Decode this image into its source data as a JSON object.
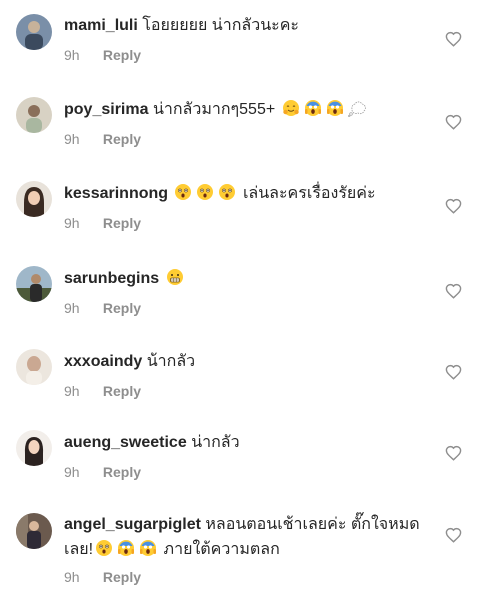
{
  "comments": [
    {
      "username": "mami_luli",
      "text": "โอยยยยย น่ากลัวนะคะ",
      "time": "9h",
      "reply_label": "Reply",
      "avatar_icon": "user-avatar-photo",
      "avatar_colors": [
        "#7a8fa8",
        "#c7b29a"
      ]
    },
    {
      "username": "poy_sirima",
      "text": "น่ากลัวมากๆ555+",
      "emojis": [
        "hugging-face-emoji",
        "screaming-face-emoji",
        "screaming-face-emoji",
        "thought-bubble-emoji"
      ],
      "time": "9h",
      "reply_label": "Reply",
      "avatar_icon": "user-avatar-photo",
      "avatar_colors": [
        "#d8d2c4",
        "#8a6f5a"
      ]
    },
    {
      "username": "kessarinnong",
      "emojis": [
        "astonished-face-emoji",
        "astonished-face-emoji",
        "astonished-face-emoji"
      ],
      "text_after": "เล่นละครเรื่องรัยค่ะ",
      "time": "9h",
      "reply_label": "Reply",
      "avatar_icon": "user-avatar-photo",
      "avatar_colors": [
        "#e8e2da",
        "#3a2a22"
      ]
    },
    {
      "username": "sarunbegins",
      "emojis": [
        "grimacing-face-emoji"
      ],
      "time": "9h",
      "reply_label": "Reply",
      "avatar_icon": "user-avatar-photo",
      "avatar_colors": [
        "#9fb7c9",
        "#4d5a3a"
      ]
    },
    {
      "username": "xxxoaindy",
      "text": "น้ากลัว",
      "time": "9h",
      "reply_label": "Reply",
      "avatar_icon": "user-avatar-photo",
      "avatar_colors": [
        "#ece6de",
        "#caa892"
      ]
    },
    {
      "username": "aueng_sweetice",
      "text": "น่ากลัว",
      "time": "9h",
      "reply_label": "Reply",
      "avatar_icon": "user-avatar-photo",
      "avatar_colors": [
        "#f2eeea",
        "#2b2220"
      ]
    },
    {
      "username": "angel_sugarpiglet",
      "text": "หลอนตอนเช้าเลยค่ะ ตั๊กใจหมด",
      "line2_text": "เลย!",
      "emojis": [
        "astonished-face-emoji",
        "screaming-face-emoji",
        "screaming-face-emoji"
      ],
      "text_after": "ภายใต้ความตลก",
      "time": "9h",
      "reply_label": "Reply",
      "avatar_icon": "user-avatar-photo",
      "avatar_colors": [
        "#6b5a4e",
        "#2e2a36"
      ]
    }
  ],
  "colors": {
    "username": "#262626",
    "meta": "#8e8e8e",
    "heart_stroke": "#8e8e8e",
    "emoji_yellow": "#ffcc33",
    "emoji_blue": "#4a90e2"
  }
}
